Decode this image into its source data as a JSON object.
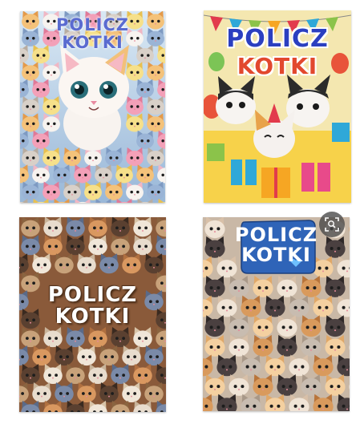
{
  "cards": [
    {
      "title_line1": "POLICZ",
      "title_line2": "KOTKI"
    },
    {
      "title_line1": "POLICZ",
      "title_line2": "KOTKI"
    },
    {
      "title_line1": "POLICZ",
      "title_line2": "KOTKI"
    },
    {
      "title_line1": "POLICZ",
      "title_line2": "KOTKI"
    }
  ],
  "icons": {
    "visual_search": "visual-search-icon"
  },
  "colors": {
    "card1_title": "#5a6bd0",
    "card2_title_top": "#2b3fc0",
    "card2_title_bottom": "#e2482e",
    "card3_title": "#ffffff",
    "card4_banner": "#2f64b8"
  }
}
